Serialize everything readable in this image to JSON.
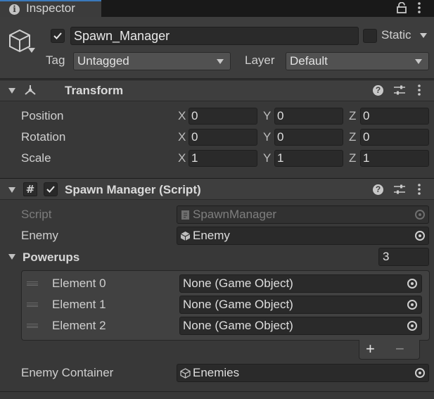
{
  "tab": {
    "label": "Inspector"
  },
  "object": {
    "name": "Spawn_Manager",
    "active": true,
    "static_label": "Static",
    "tag_label": "Tag",
    "tag_value": "Untagged",
    "layer_label": "Layer",
    "layer_value": "Default"
  },
  "transform": {
    "title": "Transform",
    "rows": [
      {
        "label": "Position",
        "x": "0",
        "y": "0",
        "z": "0"
      },
      {
        "label": "Rotation",
        "x": "0",
        "y": "0",
        "z": "0"
      },
      {
        "label": "Scale",
        "x": "1",
        "y": "1",
        "z": "1"
      }
    ],
    "axes": {
      "x": "X",
      "y": "Y",
      "z": "Z"
    }
  },
  "spawn_manager": {
    "title": "Spawn Manager (Script)",
    "enabled": true,
    "script_label": "Script",
    "script_value": "SpawnManager",
    "enemy_label": "Enemy",
    "enemy_value": "Enemy",
    "powerups_label": "Powerups",
    "powerups_size": "3",
    "elements": [
      {
        "label": "Element 0",
        "value": "None (Game Object)"
      },
      {
        "label": "Element 1",
        "value": "None (Game Object)"
      },
      {
        "label": "Element 2",
        "value": "None (Game Object)"
      }
    ],
    "add_label": "+",
    "remove_label": "−",
    "enemy_container_label": "Enemy Container",
    "enemy_container_value": "Enemies"
  },
  "colors": {
    "background": "#383838",
    "field": "#2a2a2a",
    "tab_accent": "#3a79bb"
  },
  "icons": {
    "tab": "info-icon",
    "lock": "lock-icon",
    "menu": "kebab-menu-icon",
    "object": "cube-icon",
    "transform": "transform-axes-icon",
    "script": "hash-script-icon",
    "help": "help-icon",
    "presets": "presets-sliders-icon"
  }
}
